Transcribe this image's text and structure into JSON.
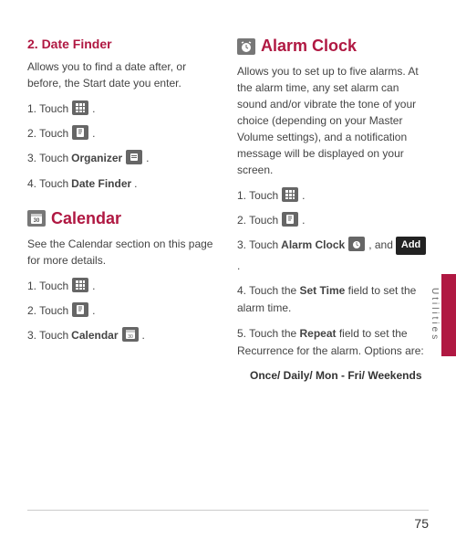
{
  "page_number": "75",
  "side_label": "Utilities",
  "left": {
    "dateFinder": {
      "title": "2. Date Finder",
      "desc": "Allows you to find a date after, or before, the Start date you enter.",
      "s1_a": "1. Touch ",
      "s1_b": ".",
      "s2_a": "2. Touch ",
      "s2_b": ".",
      "s3_a": "3. Touch ",
      "s3_bold": "Organizer",
      "s3_b": " .",
      "s4_a": "4. Touch ",
      "s4_bold": "Date Finder",
      "s4_b": "."
    },
    "calendar": {
      "title": "Calendar",
      "desc": "See the Calendar section on this page for more details.",
      "s1_a": "1. Touch ",
      "s1_b": ".",
      "s2_a": "2. Touch ",
      "s2_b": ".",
      "s3_a": "3.  Touch ",
      "s3_bold": "Calendar",
      "s3_b": " ."
    }
  },
  "right": {
    "alarm": {
      "title": "Alarm Clock",
      "desc": "Allows you to set up to five alarms. At the alarm time, any set alarm can sound and/or vibrate the tone of your choice (depending on your Master Volume settings), and a notification message will be displayed on your screen.",
      "s1_a": "1. Touch ",
      "s1_b": ".",
      "s2_a": "2. Touch ",
      "s2_b": ".",
      "s3_a": "3. Touch ",
      "s3_bold": "Alarm Clock",
      "s3_mid": " , and ",
      "s3_add": "Add",
      "s3_b": " .",
      "s4_a": "4. Touch the ",
      "s4_bold": "Set Time",
      "s4_b": " field to set the alarm time.",
      "s5_a": "5. Touch the ",
      "s5_bold": "Repeat",
      "s5_b": " field to set the Recurrence for the alarm. Options are:",
      "options": "Once/ Daily/ Mon - Fri/ Weekends"
    }
  }
}
